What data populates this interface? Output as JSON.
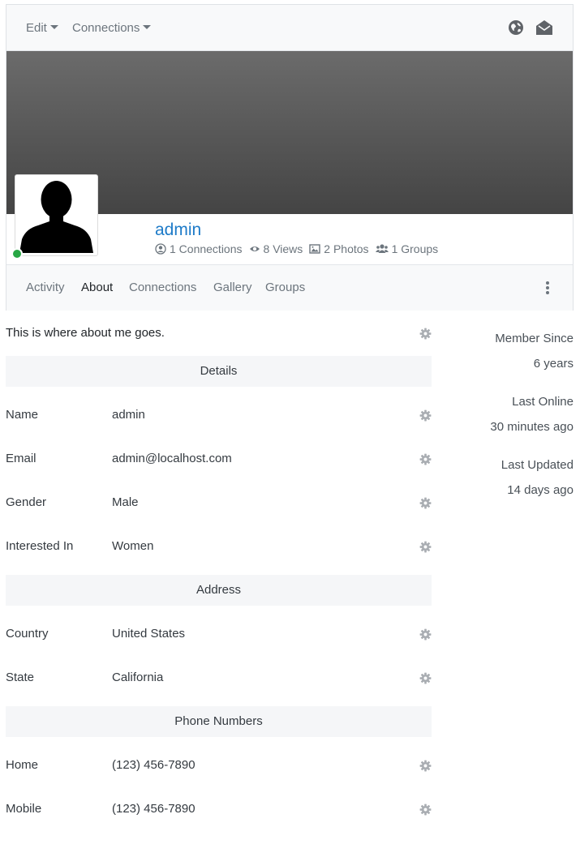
{
  "toolbar": {
    "edit_label": "Edit",
    "connections_label": "Connections"
  },
  "profile": {
    "username": "admin",
    "stats": {
      "connections": "1 Connections",
      "views": "8 Views",
      "photos": "2 Photos",
      "groups": "1 Groups"
    }
  },
  "tabs": {
    "activity": "Activity",
    "about": "About",
    "connections": "Connections",
    "gallery": "Gallery",
    "groups": "Groups",
    "active": "About"
  },
  "about": {
    "text": "This is where about me goes."
  },
  "sections": {
    "details": {
      "title": "Details",
      "name_label": "Name",
      "name_value": "admin",
      "email_label": "Email",
      "email_value": "admin@localhost.com",
      "gender_label": "Gender",
      "gender_value": "Male",
      "interested_label": "Interested In",
      "interested_value": "Women"
    },
    "address": {
      "title": "Address",
      "country_label": "Country",
      "country_value": "United States",
      "state_label": "State",
      "state_value": "California"
    },
    "phones": {
      "title": "Phone Numbers",
      "home_label": "Home",
      "home_value": "(123) 456-7890",
      "mobile_label": "Mobile",
      "mobile_value": "(123) 456-7890"
    }
  },
  "sidebar": {
    "member_since_label": "Member Since",
    "member_since_value": "6 years",
    "last_online_label": "Last Online",
    "last_online_value": "30 minutes ago",
    "last_updated_label": "Last Updated",
    "last_updated_value": "14 days ago"
  },
  "icons": {
    "globe": "globe-icon",
    "envelope": "envelope-open-icon",
    "gear": "gear-icon",
    "user": "user-circle-icon",
    "eye": "eye-icon",
    "image": "image-icon",
    "users": "users-icon",
    "kebab": "kebab-icon"
  },
  "colors": {
    "username": "#1e7bc8",
    "online": "#28a745",
    "muted": "#6c757d"
  }
}
